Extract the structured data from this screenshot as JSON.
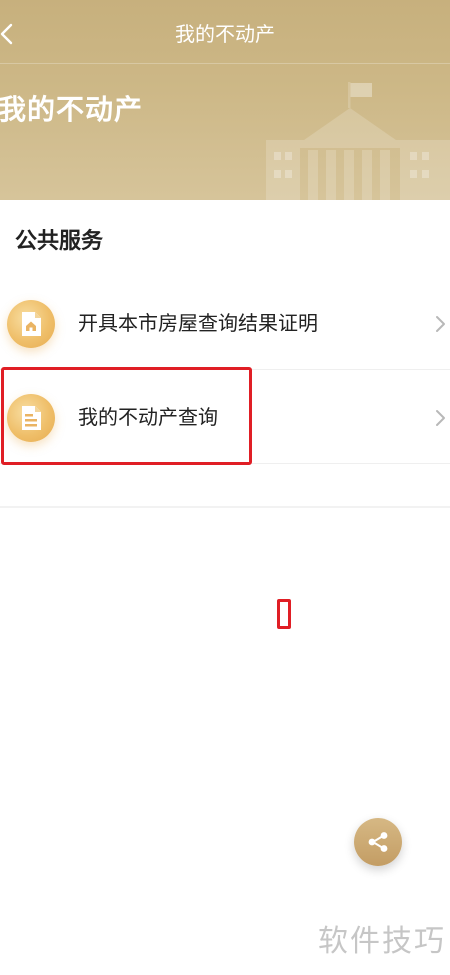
{
  "navbar": {
    "title": "我的不动产",
    "back_icon": "chevron-left-icon"
  },
  "banner": {
    "title": "我的不动产",
    "illustration_icon": "government-building-icon"
  },
  "section": {
    "title": "公共服务"
  },
  "items": [
    {
      "label": "开具本市房屋查询结果证明",
      "icon": "house-document-icon"
    },
    {
      "label": "我的不动产查询",
      "icon": "document-icon"
    }
  ],
  "share": {
    "icon": "share-icon"
  },
  "watermark": {
    "text": "软件技巧"
  },
  "colors": {
    "header": "#cdb887",
    "icon_gold": "#efbf6a",
    "highlight": "#e01e25"
  }
}
